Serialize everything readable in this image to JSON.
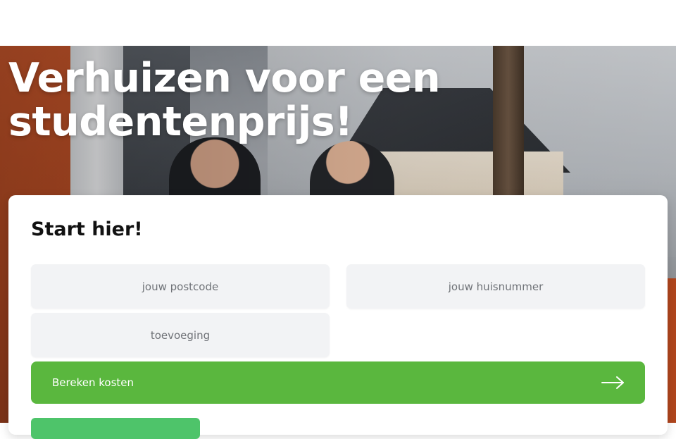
{
  "hero": {
    "title": "Verhuizen voor een studentenprijs!"
  },
  "form": {
    "title": "Start hier!",
    "postcode_placeholder": "jouw postcode",
    "huisnummer_placeholder": "jouw huisnummer",
    "toevoeging_placeholder": "toevoeging",
    "submit_label": "Bereken kosten",
    "submit_icon": "arrow-right-icon"
  },
  "colors": {
    "accent_green": "#5ab73e",
    "field_background": "#f2f3f5"
  }
}
